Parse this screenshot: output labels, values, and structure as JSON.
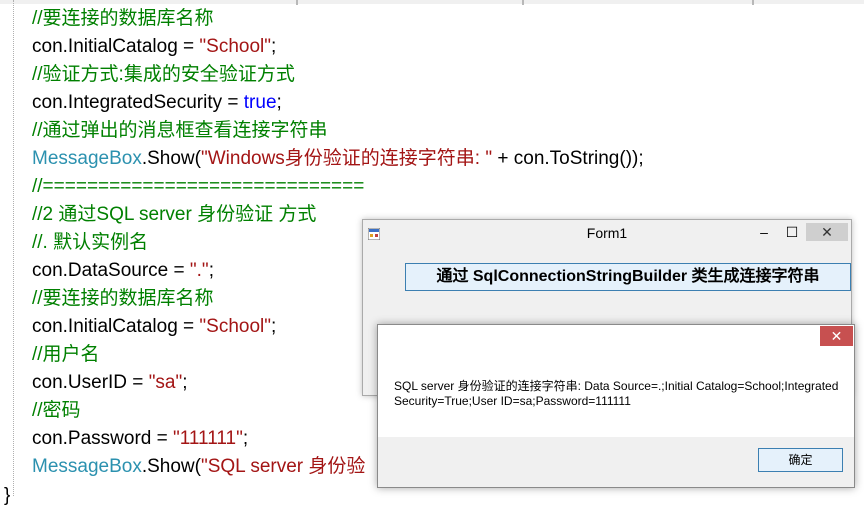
{
  "editor": {
    "lines": [
      [
        {
          "t": "//要连接的数据库名称",
          "c": "c-comment"
        }
      ],
      [
        {
          "t": "con.InitialCatalog = ",
          "c": "c-plain"
        },
        {
          "t": "\"School\"",
          "c": "c-str"
        },
        {
          "t": ";",
          "c": "c-plain"
        }
      ],
      [
        {
          "t": "//验证方式:集成的安全验证方式",
          "c": "c-comment"
        }
      ],
      [
        {
          "t": "con.IntegratedSecurity = ",
          "c": "c-plain"
        },
        {
          "t": "true",
          "c": "c-kw"
        },
        {
          "t": ";",
          "c": "c-plain"
        }
      ],
      [
        {
          "t": "//通过弹出的消息框查看连接字符串",
          "c": "c-comment"
        }
      ],
      [
        {
          "t": "MessageBox",
          "c": "c-type"
        },
        {
          "t": ".Show(",
          "c": "c-plain"
        },
        {
          "t": "\"Windows身份验证的连接字符串: \"",
          "c": "c-str"
        },
        {
          "t": " + con.ToString());",
          "c": "c-plain"
        }
      ],
      [
        {
          "t": "//=============================",
          "c": "c-comment"
        }
      ],
      [
        {
          "t": "//2 通过SQL server 身份验证 方式",
          "c": "c-comment"
        }
      ],
      [
        {
          "t": "//. 默认实例名",
          "c": "c-comment"
        }
      ],
      [
        {
          "t": "con.DataSource = ",
          "c": "c-plain"
        },
        {
          "t": "\".\"",
          "c": "c-str"
        },
        {
          "t": ";",
          "c": "c-plain"
        }
      ],
      [
        {
          "t": "//要连接的数据库名称",
          "c": "c-comment"
        }
      ],
      [
        {
          "t": "con.InitialCatalog = ",
          "c": "c-plain"
        },
        {
          "t": "\"School\"",
          "c": "c-str"
        },
        {
          "t": ";",
          "c": "c-plain"
        }
      ],
      [
        {
          "t": "//用户名",
          "c": "c-comment"
        }
      ],
      [
        {
          "t": "con.UserID = ",
          "c": "c-plain"
        },
        {
          "t": "\"sa\"",
          "c": "c-str"
        },
        {
          "t": ";",
          "c": "c-plain"
        }
      ],
      [
        {
          "t": "//密码",
          "c": "c-comment"
        }
      ],
      [
        {
          "t": "con.Password = ",
          "c": "c-plain"
        },
        {
          "t": "\"111111\"",
          "c": "c-str"
        },
        {
          "t": ";",
          "c": "c-plain"
        }
      ],
      [
        {
          "t": "MessageBox",
          "c": "c-type"
        },
        {
          "t": ".Show(",
          "c": "c-plain"
        },
        {
          "t": "\"SQL server 身份验",
          "c": "c-str"
        }
      ]
    ],
    "closing_brace": "}"
  },
  "form1": {
    "title": "Form1",
    "minimize_glyph": "–",
    "maximize_glyph": "☐",
    "close_glyph": "✕",
    "button_label": "通过 SqlConnectionStringBuilder 类生成连接字符串"
  },
  "msgbox": {
    "close_glyph": "✕",
    "message": "SQL server 身份验证的连接字符串: Data Source=.;Initial Catalog=School;Integrated Security=True;User ID=sa;Password=111111",
    "ok_label": "确定"
  }
}
